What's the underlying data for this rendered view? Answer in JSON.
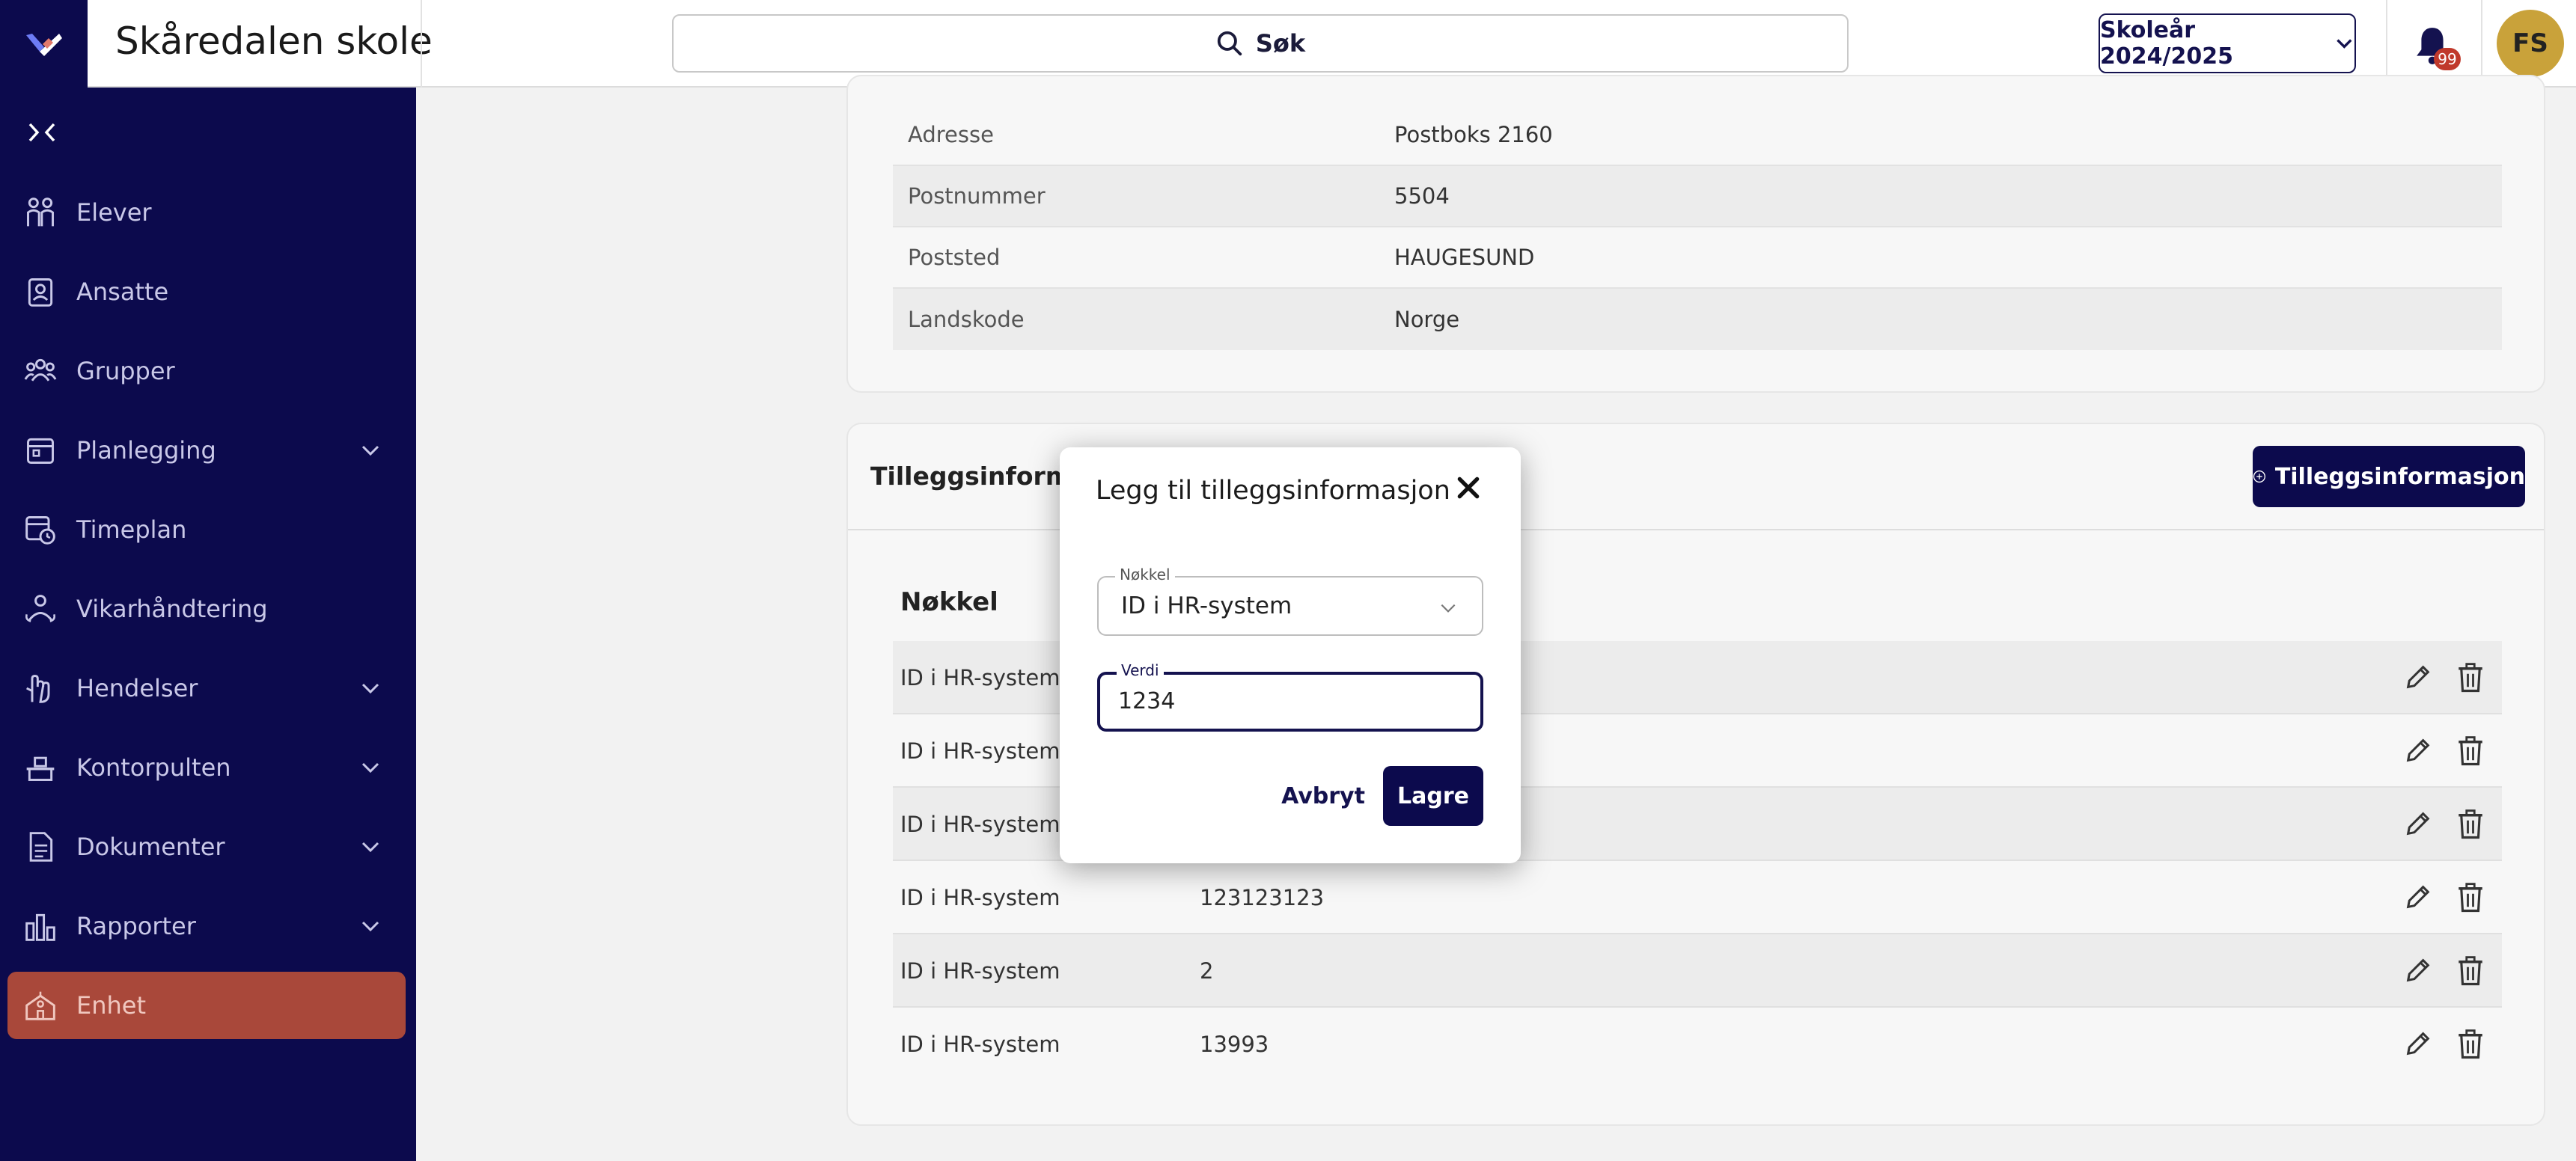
{
  "header": {
    "school_name": "Skåredalen skole",
    "search_label": "Søk",
    "year_selector": "Skoleår 2024/2025",
    "notification_count": "99",
    "avatar_initials": "FS"
  },
  "sidebar": {
    "items": [
      {
        "label": "Elever",
        "icon": "students-icon",
        "expandable": false
      },
      {
        "label": "Ansatte",
        "icon": "employee-badge-icon",
        "expandable": false
      },
      {
        "label": "Grupper",
        "icon": "groups-icon",
        "expandable": false
      },
      {
        "label": "Planlegging",
        "icon": "planning-icon",
        "expandable": true
      },
      {
        "label": "Timeplan",
        "icon": "timetable-icon",
        "expandable": false
      },
      {
        "label": "Vikarhåndtering",
        "icon": "substitute-icon",
        "expandable": false
      },
      {
        "label": "Hendelser",
        "icon": "events-hand-icon",
        "expandable": true
      },
      {
        "label": "Kontorpulten",
        "icon": "desk-icon",
        "expandable": true
      },
      {
        "label": "Dokumenter",
        "icon": "document-icon",
        "expandable": true
      },
      {
        "label": "Rapporter",
        "icon": "bar-chart-icon",
        "expandable": true
      },
      {
        "label": "Enhet",
        "icon": "school-building-icon",
        "expandable": false,
        "active": true
      }
    ]
  },
  "address": {
    "rows": [
      {
        "key": "Adresse",
        "value": "Postboks 2160"
      },
      {
        "key": "Postnummer",
        "value": "5504"
      },
      {
        "key": "Poststed",
        "value": "HAUGESUND"
      },
      {
        "key": "Landskode",
        "value": "Norge"
      }
    ]
  },
  "additional_info": {
    "title": "Tilleggsinformas",
    "add_button": "Tilleggsinformasjon",
    "column_key": "Nøkkel",
    "rows": [
      {
        "key": "ID i HR-system",
        "value": ""
      },
      {
        "key": "ID i HR-system",
        "value": ""
      },
      {
        "key": "ID i HR-system",
        "value": ""
      },
      {
        "key": "ID i HR-system",
        "value": "123123123"
      },
      {
        "key": "ID i HR-system",
        "value": "2"
      },
      {
        "key": "ID i HR-system",
        "value": "13993"
      }
    ]
  },
  "modal": {
    "title": "Legg til tilleggsinformasjon",
    "key_label": "Nøkkel",
    "key_value": "ID i HR-system",
    "value_label": "Verdi",
    "value_value": "1234",
    "cancel_label": "Avbryt",
    "save_label": "Lagre"
  },
  "colors": {
    "brand_navy": "#0c0a4d",
    "active_item": "#a9483a",
    "badge": "#c0392b",
    "avatar": "#c9a23a"
  }
}
